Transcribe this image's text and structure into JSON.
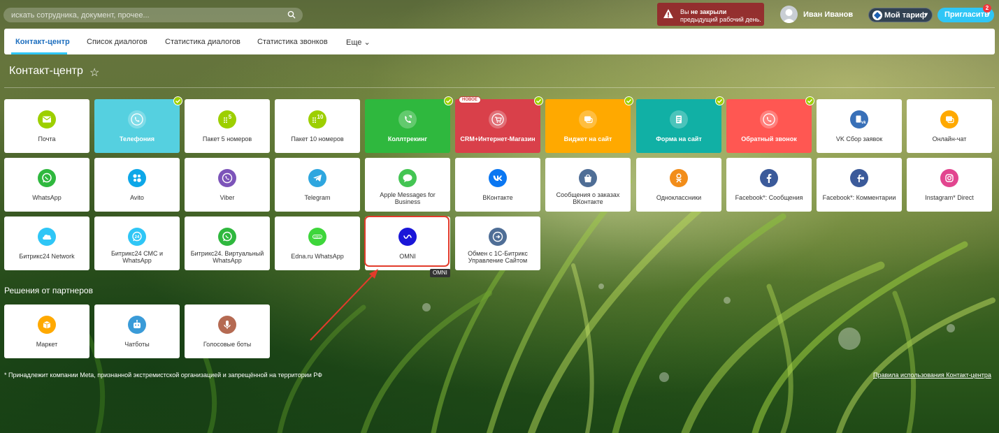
{
  "topbar": {
    "search_placeholder": "искать сотрудника, документ, прочее...",
    "warning": {
      "pre": "Вы ",
      "bold": "не закрыли",
      "line2": "предыдущий рабочий день."
    },
    "user_name": "Иван Иванов",
    "tariff_label": "Мой тариф",
    "invite_label": "Пригласить",
    "invite_badge": "2"
  },
  "nav": {
    "tabs": [
      "Контакт-центр",
      "Список диалогов",
      "Статистика диалогов",
      "Статистика звонков",
      "Еще"
    ]
  },
  "page": {
    "title": "Контакт-центр",
    "partners_title": "Решения от партнеров",
    "footnote": "* Принадлежит компании Meta, признанной экстремистской организацией и запрещённой на территории РФ",
    "rules_link": "Правила использования Контакт-центра",
    "tooltip": "OMNI",
    "new_badge": "НОВОЕ"
  },
  "colors": {
    "green": "#9dcf00",
    "telephony": "#55d0e0",
    "calltracking": "#2fb83e",
    "crm_shop": "#d9404a",
    "widget": "#ffa900",
    "form": "#11b0a5",
    "callback": "#ff5752",
    "accent": "#2fc6f6"
  },
  "tiles": [
    {
      "label": "Почта"
    },
    {
      "label": "Телефония"
    },
    {
      "label": "Пакет 5 номеров"
    },
    {
      "label": "Пакет 10 номеров"
    },
    {
      "label": "Коллтрекинг"
    },
    {
      "label": "CRM+Интернет-Магазин"
    },
    {
      "label": "Виджет на сайт"
    },
    {
      "label": "Форма на сайт"
    },
    {
      "label": "Обратный звонок"
    },
    {
      "label": "VK Сбор заявок"
    },
    {
      "label": "Онлайн-чат"
    },
    {
      "label": "WhatsApp"
    },
    {
      "label": "Avito"
    },
    {
      "label": "Viber"
    },
    {
      "label": "Telegram"
    },
    {
      "label": "Apple Messages for Business"
    },
    {
      "label": "ВКонтакте"
    },
    {
      "label": "Сообщения о заказах ВКонтакте"
    },
    {
      "label": "Одноклассники"
    },
    {
      "label": "Facebook*: Сообщения"
    },
    {
      "label": "Facebook*: Комментарии"
    },
    {
      "label": "Instagram* Direct"
    },
    {
      "label": "Битрикс24 Network"
    },
    {
      "label": "Битрикс24 СМС и WhatsApp"
    },
    {
      "label": "Битрикс24. Виртуальный WhatsApp"
    },
    {
      "label": "Edna.ru WhatsApp"
    },
    {
      "label": "OMNI"
    },
    {
      "label": "Обмен с 1С-Битрикс Управление Сайтом"
    }
  ],
  "partner_tiles": [
    {
      "label": "Маркет"
    },
    {
      "label": "Чатботы"
    },
    {
      "label": "Голосовые боты"
    }
  ]
}
